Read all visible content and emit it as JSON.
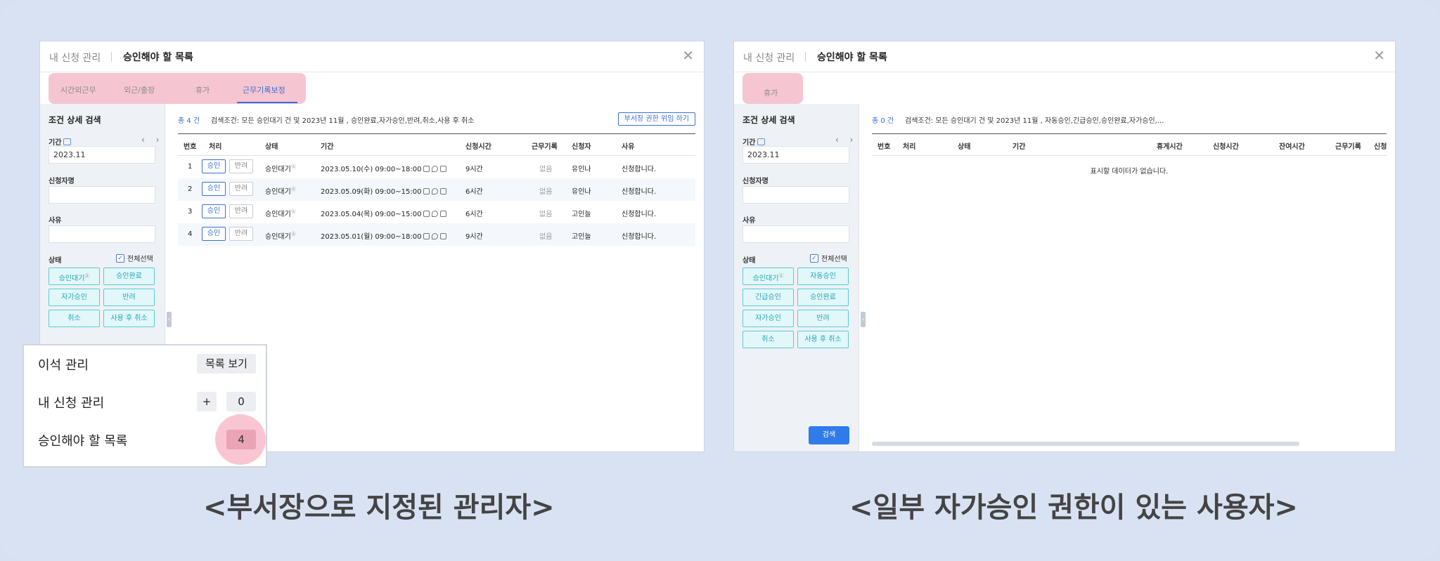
{
  "left_panel": {
    "header": {
      "tab1": "내 신청 관리",
      "tab2": "승인해야 할 목록"
    },
    "tabs": [
      "시간외근무",
      "외근/출장",
      "휴가",
      "근무기록보정"
    ],
    "sidebar": {
      "title": "조건 상세 검색",
      "period_label": "기간",
      "period_value": "2023.11",
      "nav_arrows": "‹ ›",
      "applicant_label": "신청자명",
      "reason_label": "사유",
      "status_label": "상태",
      "select_all": "전체선택",
      "check": "✓",
      "chips": [
        "승인대기",
        "승인완료",
        "자가승인",
        "반려",
        "취소",
        "사용 후 취소"
      ],
      "chip_sup": "Ⓐ"
    },
    "content": {
      "total": "총 4 건",
      "conditions": "검색조건: 모든 승인대기 건 및 2023년 11월 , 승인완료,자가승인,반려,취소,사용 후 취소",
      "delegate_button": "부서장 권한 위임 하기",
      "columns": [
        "번호",
        "처리",
        "상태",
        "기간",
        "신청시간",
        "근무기록",
        "신청자",
        "사유"
      ],
      "approve_label": "승인",
      "reject_label": "반려",
      "rows": [
        {
          "no": "1",
          "status": "승인대기",
          "period": "2023.05.10(수) 09:00~18:00",
          "hours": "9시간",
          "record": "없음",
          "applicant": "유인나",
          "reason": "신청합니다."
        },
        {
          "no": "2",
          "status": "승인대기",
          "period": "2023.05.09(화) 09:00~15:00",
          "hours": "6시간",
          "record": "없음",
          "applicant": "유인나",
          "reason": "신청합니다."
        },
        {
          "no": "3",
          "status": "승인대기",
          "period": "2023.05.04(목) 09:00~15:00",
          "hours": "6시간",
          "record": "없음",
          "applicant": "고인늘",
          "reason": "신청합니다."
        },
        {
          "no": "4",
          "status": "승인대기",
          "period": "2023.05.01(월) 09:00~18:00",
          "hours": "9시간",
          "record": "없음",
          "applicant": "고인늘",
          "reason": "신청합니다."
        }
      ],
      "status_sup": "Ⓐ"
    }
  },
  "overlay": {
    "row1_label": "이석 관리",
    "row1_button": "목록 보기",
    "row2_label": "내 신청 관리",
    "row2_plus": "+",
    "row2_count": "0",
    "row3_label": "승인해야 할 목록",
    "row3_count": "4"
  },
  "right_panel": {
    "header": {
      "tab1": "내 신청 관리",
      "tab2": "승인해야 할 목록"
    },
    "tabs": [
      "휴가"
    ],
    "sidebar": {
      "title": "조건 상세 검색",
      "period_label": "기간",
      "period_value": "2023.11",
      "nav_arrows": "‹ ›",
      "applicant_label": "신청자명",
      "reason_label": "사유",
      "status_label": "상태",
      "select_all": "전체선택",
      "check": "✓",
      "chips": [
        "승인대기",
        "자동승인",
        "긴급승인",
        "승인완료",
        "자가승인",
        "반려",
        "취소",
        "사용 후 취소"
      ],
      "chip_sup": "Ⓐ",
      "search_button": "검색"
    },
    "content": {
      "total": "총 0 건",
      "conditions": "검색조건: 모든 승인대기 건 및 2023년 11월 , 자동승인,긴급승인,승인완료,자가승인,...",
      "columns": [
        "번호",
        "처리",
        "상태",
        "기간",
        "휴게시간",
        "신청시간",
        "잔여시간",
        "근무기록",
        "신청"
      ],
      "empty_message": "표시할 데이터가 없습니다."
    }
  },
  "captions": {
    "left": "<부서장으로 지정된 관리자>",
    "right": "<일부 자가승인 권한이 있는 사용자>"
  },
  "colors": {
    "accent": "#3c6fd1",
    "chip": "#22a8b5",
    "highlight": "#f5c6d2",
    "search_button": "#2f7bea"
  }
}
